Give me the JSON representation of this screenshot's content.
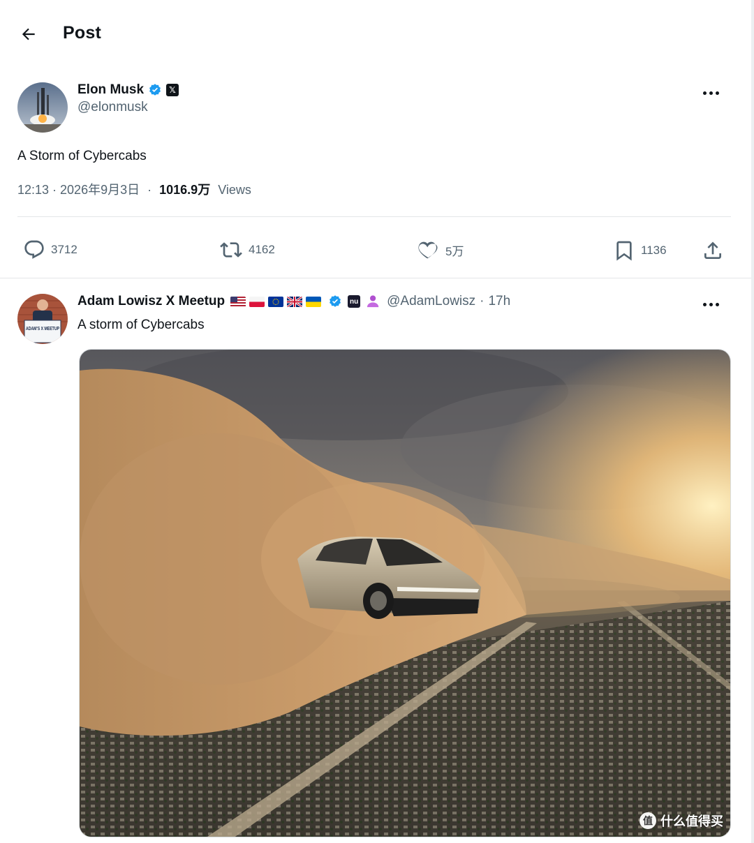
{
  "header": {
    "title": "Post"
  },
  "main_post": {
    "author_name": "Elon Musk",
    "author_handle": "@elonmusk",
    "x_badge": "𝕏",
    "text": "A Storm of Cybercabs",
    "timestamp": "12:13 · 2026年9月3日",
    "separator": "·",
    "views_count": "1016.9万",
    "views_label": "Views",
    "stats": {
      "replies": "3712",
      "reposts": "4162",
      "likes": "5万",
      "bookmarks": "1136"
    }
  },
  "reply_post": {
    "author_name": "Adam Lowisz X Meetup",
    "author_handle": "@AdamLowisz",
    "time_separator": "·",
    "time_ago": "17h",
    "text": "A storm of Cybercabs",
    "badge_label": "nu",
    "avatar_sign": "ADAM'S X MEETUP",
    "flags": [
      "us-flag",
      "poland-flag",
      "eu-flag",
      "uk-flag",
      "ukraine-flag"
    ]
  },
  "watermark": {
    "logo": "值",
    "text": "什么值得买"
  },
  "colors": {
    "text_primary": "#0f1419",
    "text_secondary": "#536471",
    "verified_blue": "#1d9bf0",
    "divider": "#e3e6e8"
  }
}
